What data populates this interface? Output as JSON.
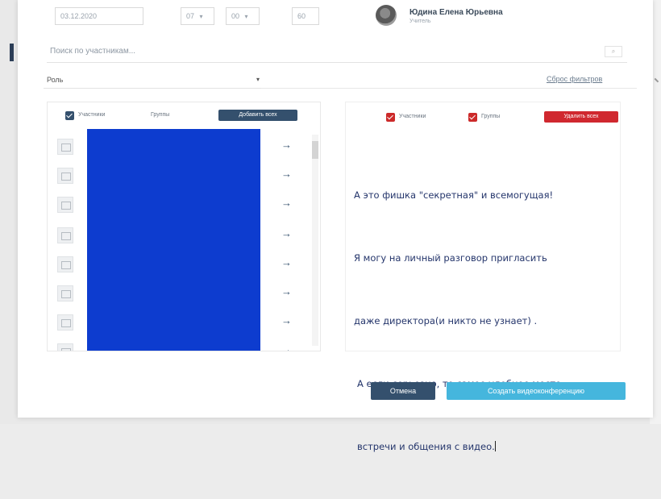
{
  "top": {
    "date": "03.12.2020",
    "hour": "07",
    "minute": "00",
    "duration": "60",
    "caret": "▾",
    "organizer_name": "Юдина Елена Юрьевна",
    "organizer_role": "Учитель"
  },
  "search": {
    "placeholder": "Поиск по участникам...",
    "button": "⌕"
  },
  "role_filter": {
    "value": "Роль",
    "caret": "▾",
    "reset_label": "Сброс фильтров"
  },
  "left_panel": {
    "participants_label": "Участники",
    "groups_label": "Группы",
    "add_all_label": "Добавить всех",
    "rows": [
      {
        "name": "",
        "arrow": "→"
      },
      {
        "name": "",
        "arrow": "→"
      },
      {
        "name": "",
        "arrow": "→"
      },
      {
        "name": "",
        "arrow": "→"
      },
      {
        "name": "",
        "arrow": "→"
      },
      {
        "name": "",
        "arrow": "→"
      },
      {
        "name": "",
        "arrow": "→"
      },
      {
        "name": "",
        "arrow": "→"
      }
    ]
  },
  "right_panel": {
    "participants_label": "Участники",
    "groups_label": "Группы",
    "remove_all_label": "Удалить всех",
    "lines": [
      "А это фишка \"секретная\" и всемогущая!",
      "Я могу на личный разговор пригласить",
      "даже директора(и никто не узнает) .",
      "А если серьезно, то самое удобное место",
      "встречи и общения с видео."
    ]
  },
  "footer": {
    "cancel_label": "Отмена",
    "create_label": "Создать видеоконференцию"
  },
  "colors": {
    "navy": "#34506d",
    "red": "#d0282f",
    "accent_blue": "#45b6dd",
    "redaction": "#0d3ccf"
  }
}
